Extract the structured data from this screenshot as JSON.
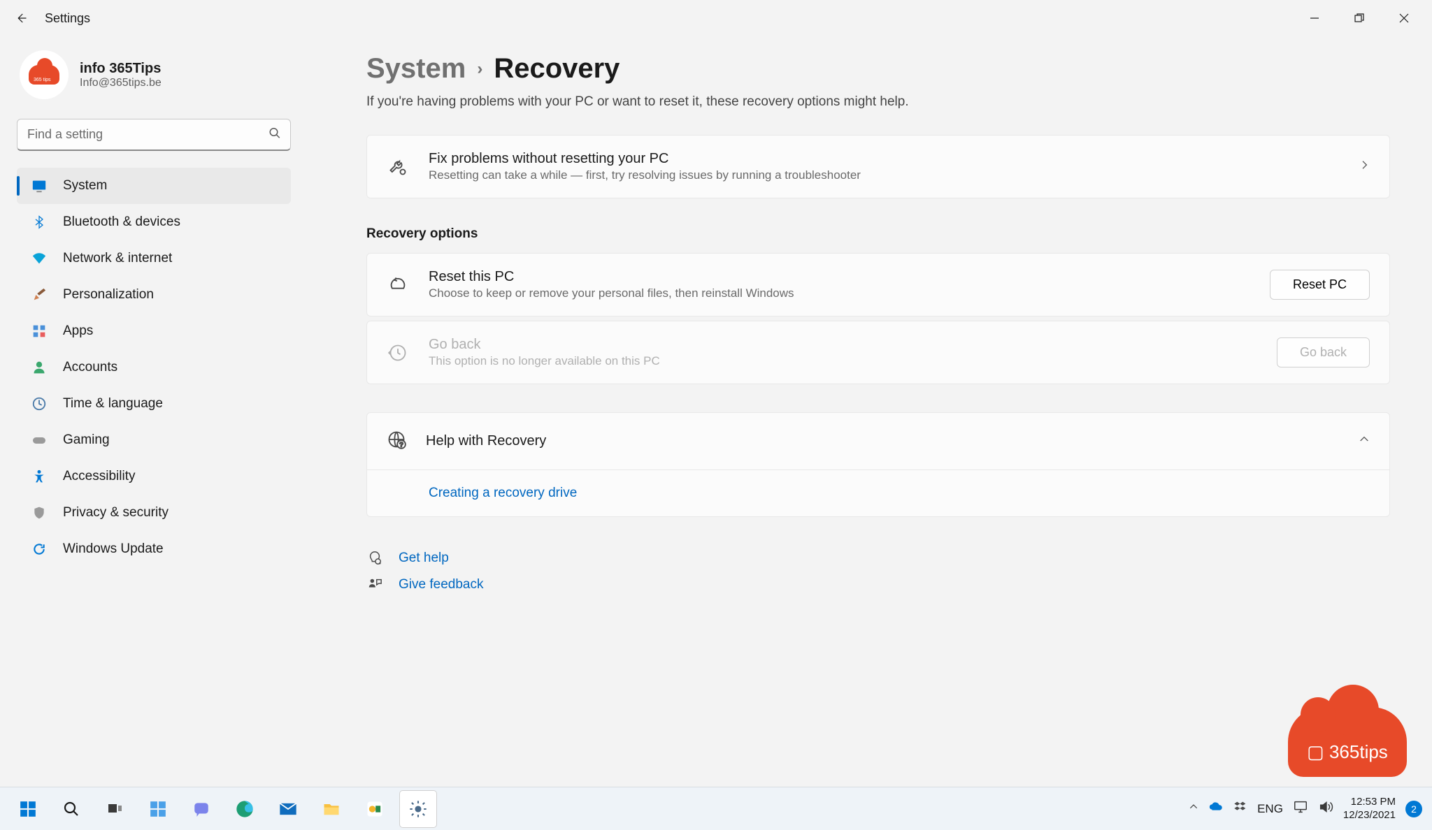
{
  "window": {
    "title": "Settings"
  },
  "user": {
    "name": "info 365Tips",
    "email": "Info@365tips.be"
  },
  "search": {
    "placeholder": "Find a setting"
  },
  "sidebar": {
    "items": [
      {
        "label": "System"
      },
      {
        "label": "Bluetooth & devices"
      },
      {
        "label": "Network & internet"
      },
      {
        "label": "Personalization"
      },
      {
        "label": "Apps"
      },
      {
        "label": "Accounts"
      },
      {
        "label": "Time & language"
      },
      {
        "label": "Gaming"
      },
      {
        "label": "Accessibility"
      },
      {
        "label": "Privacy & security"
      },
      {
        "label": "Windows Update"
      }
    ]
  },
  "breadcrumb": {
    "parent": "System",
    "current": "Recovery"
  },
  "subtitle": "If you're having problems with your PC or want to reset it, these recovery options might help.",
  "fixcard": {
    "title": "Fix problems without resetting your PC",
    "sub": "Resetting can take a while — first, try resolving issues by running a troubleshooter"
  },
  "recovery": {
    "heading": "Recovery options",
    "reset": {
      "title": "Reset this PC",
      "sub": "Choose to keep or remove your personal files, then reinstall Windows",
      "button": "Reset PC"
    },
    "goback": {
      "title": "Go back",
      "sub": "This option is no longer available on this PC",
      "button": "Go back"
    }
  },
  "help": {
    "title": "Help with Recovery",
    "link": "Creating a recovery drive"
  },
  "footlinks": {
    "help": "Get help",
    "feedback": "Give feedback"
  },
  "taskbar": {
    "lang": "ENG",
    "time": "12:53 PM",
    "date": "12/23/2021",
    "badge": "2"
  },
  "watermark": "365tips"
}
